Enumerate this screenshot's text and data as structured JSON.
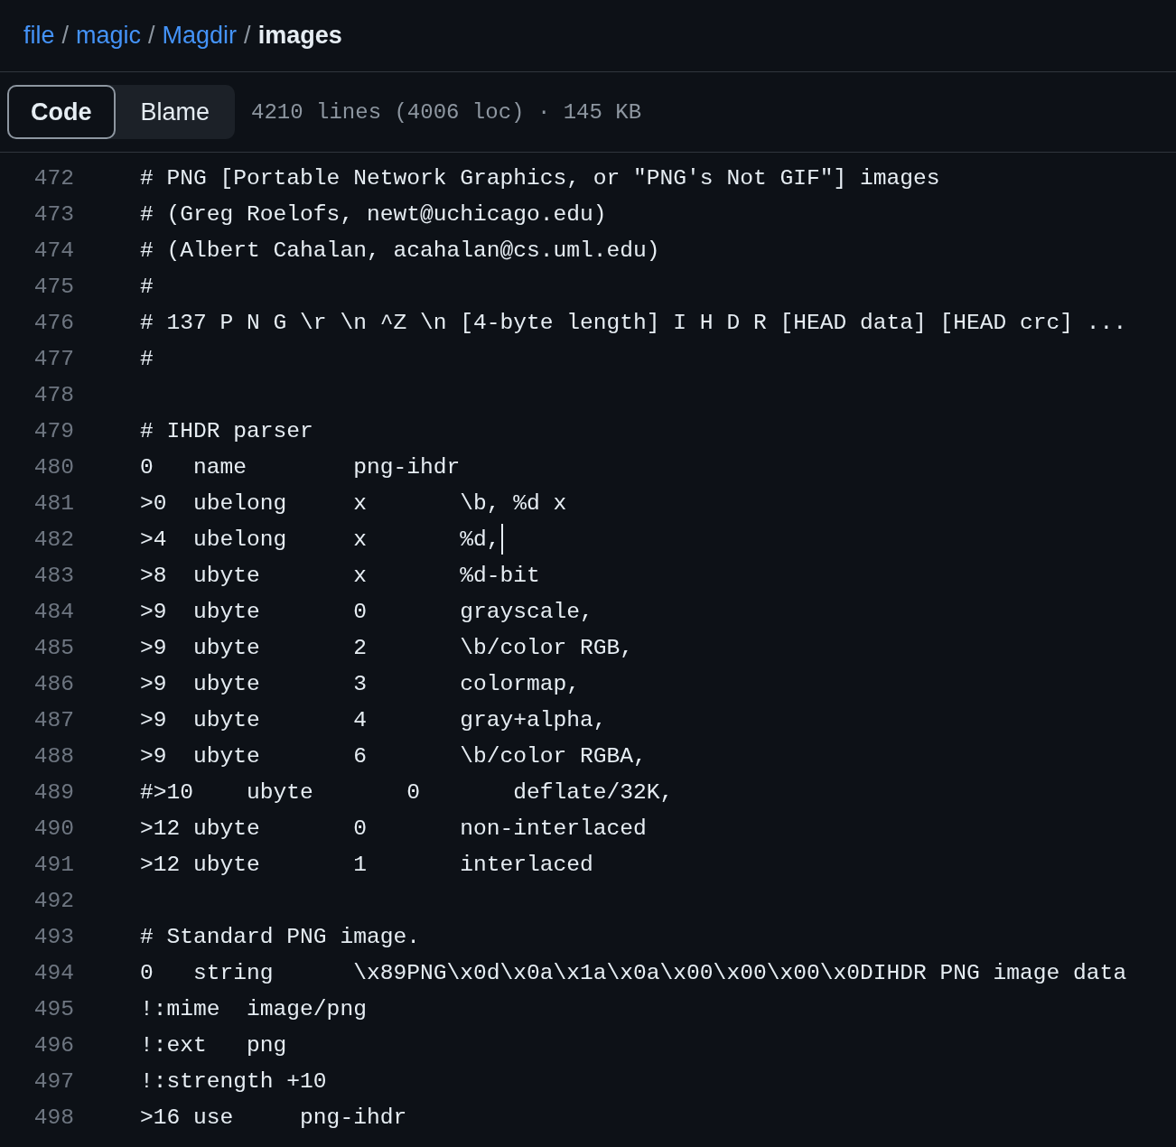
{
  "breadcrumb": [
    {
      "label": "file",
      "kind": "link"
    },
    {
      "label": "magic",
      "kind": "link"
    },
    {
      "label": "Magdir",
      "kind": "link"
    },
    {
      "label": "images",
      "kind": "current"
    }
  ],
  "separator": "/",
  "view_tabs": [
    {
      "label": "Code",
      "selected": true
    },
    {
      "label": "Blame",
      "selected": false
    }
  ],
  "file_stats": "4210 lines (4006 loc) · 145 KB",
  "code_lines": [
    {
      "number": "472",
      "text": "# PNG [Portable Network Graphics, or \"PNG's Not GIF\"] images"
    },
    {
      "number": "473",
      "text": "# (Greg Roelofs, newt@uchicago.edu)"
    },
    {
      "number": "474",
      "text": "# (Albert Cahalan, acahalan@cs.uml.edu)"
    },
    {
      "number": "475",
      "text": "#"
    },
    {
      "number": "476",
      "text": "# 137 P N G \\r \\n ^Z \\n [4-byte length] I H D R [HEAD data] [HEAD crc] ..."
    },
    {
      "number": "477",
      "text": "#"
    },
    {
      "number": "478"
    },
    {
      "number": "479",
      "text": "# IHDR parser"
    },
    {
      "number": "480",
      "text": "0   name        png-ihdr"
    },
    {
      "number": "481",
      "text": ">0  ubelong     x       \\b, %d x"
    },
    {
      "number": "482",
      "text": ">4  ubelong     x       %d,",
      "cursor": true
    },
    {
      "number": "483",
      "text": ">8  ubyte       x       %d-bit"
    },
    {
      "number": "484",
      "text": ">9  ubyte       0       grayscale,"
    },
    {
      "number": "485",
      "text": ">9  ubyte       2       \\b/color RGB,"
    },
    {
      "number": "486",
      "text": ">9  ubyte       3       colormap,"
    },
    {
      "number": "487",
      "text": ">9  ubyte       4       gray+alpha,"
    },
    {
      "number": "488",
      "text": ">9  ubyte       6       \\b/color RGBA,"
    },
    {
      "number": "489",
      "text": "#>10    ubyte       0       deflate/32K,"
    },
    {
      "number": "490",
      "text": ">12 ubyte       0       non-interlaced"
    },
    {
      "number": "491",
      "text": ">12 ubyte       1       interlaced"
    },
    {
      "number": "492"
    },
    {
      "number": "493",
      "text": "# Standard PNG image."
    },
    {
      "number": "494",
      "text": "0   string      \\x89PNG\\x0d\\x0a\\x1a\\x0a\\x00\\x00\\x00\\x0DIHDR PNG image data"
    },
    {
      "number": "495",
      "text": "!:mime  image/png"
    },
    {
      "number": "496",
      "text": "!:ext   png"
    },
    {
      "number": "497",
      "text": "!:strength +10"
    },
    {
      "number": "498",
      "text": ">16 use     png-ihdr"
    }
  ]
}
